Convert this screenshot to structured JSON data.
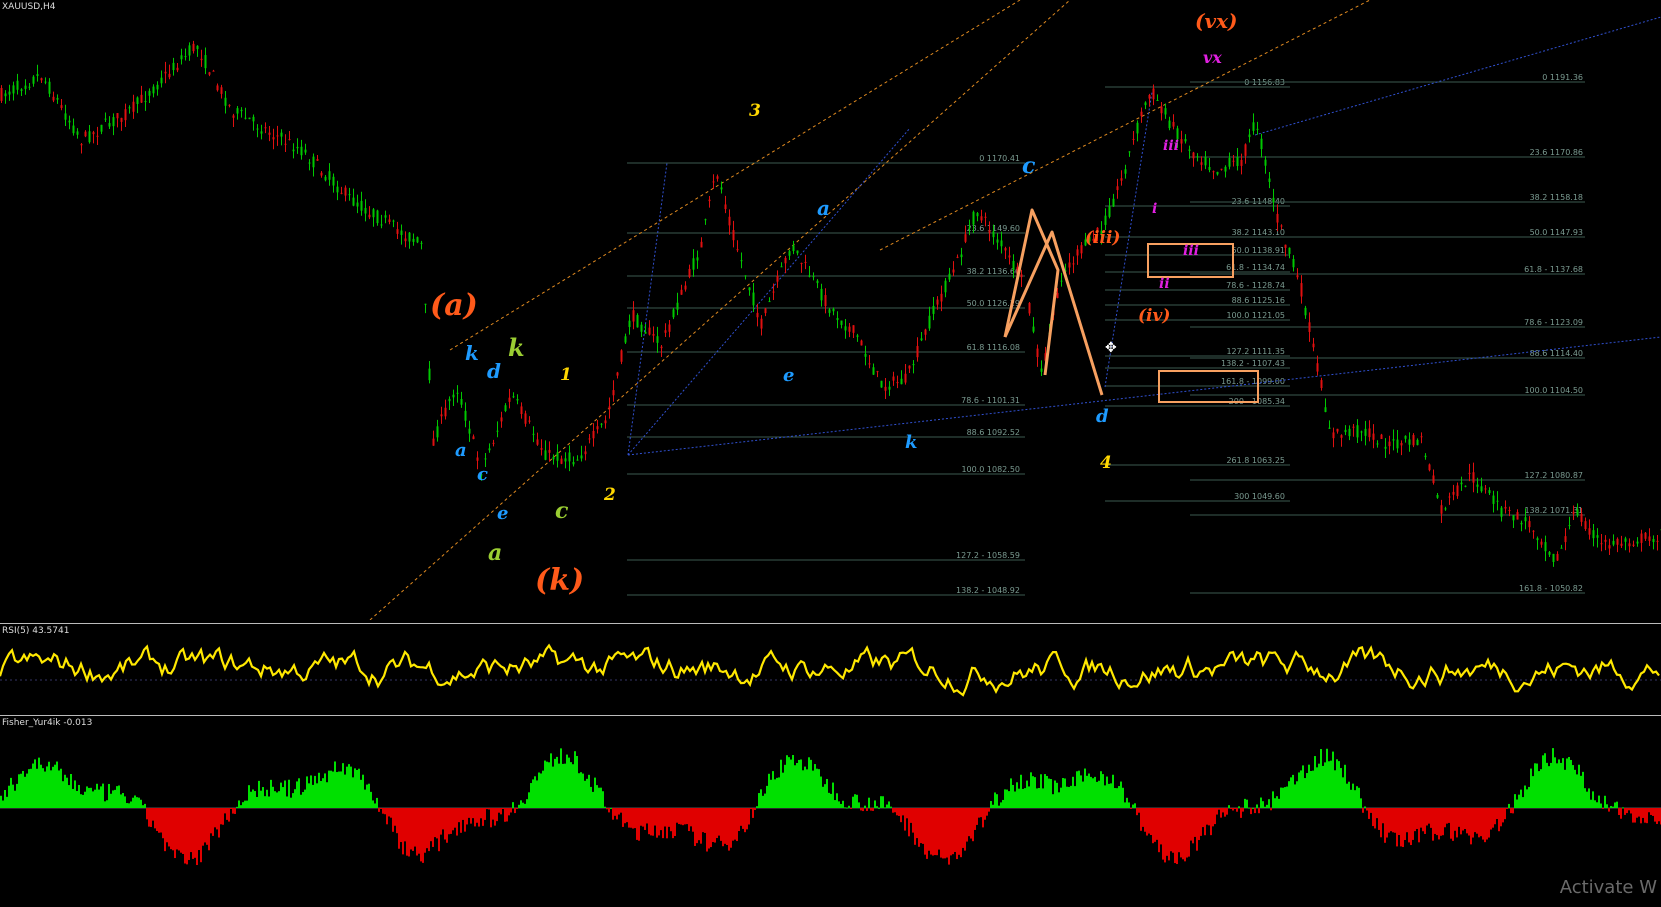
{
  "chart": {
    "symbol_title": "XAUUSD,H4",
    "colors": {
      "background": "#000000",
      "bull_candle": "#00c800",
      "bear_candle": "#e01010",
      "fib_line": "#3c5a50",
      "fib_text": "#7a9a90",
      "channel_orange": "#e08a20",
      "trend_blue": "#3050d0",
      "rsi_line": "#ffe800",
      "fisher_up": "#00e000",
      "fisher_down": "#e00000",
      "harmonic": "#f7a060"
    }
  },
  "wave_labels": [
    {
      "text": "(a)",
      "color": "#ff5a1a"
    },
    {
      "text": "(k)",
      "color": "#ff5a1a"
    },
    {
      "text": "(iii)",
      "color": "#ff5a1a"
    },
    {
      "text": "(iv)",
      "color": "#ff5a1a"
    },
    {
      "text": "(vx)",
      "color": "#ff5a1a"
    },
    {
      "text": "vx",
      "color": "#e020e0"
    },
    {
      "text": "i",
      "color": "#e020e0"
    },
    {
      "text": "ii",
      "color": "#e020e0"
    },
    {
      "text": "iii",
      "color": "#e020e0"
    },
    {
      "text": "iii",
      "color": "#e020e0"
    },
    {
      "text": "1",
      "color": "#ffd700"
    },
    {
      "text": "2",
      "color": "#ffd700"
    },
    {
      "text": "3",
      "color": "#ffd700"
    },
    {
      "text": "4",
      "color": "#ffd700"
    },
    {
      "text": "k",
      "color": "#9acd32"
    },
    {
      "text": "c",
      "color": "#9acd32"
    },
    {
      "text": "a",
      "color": "#9acd32"
    },
    {
      "text": "k",
      "color": "#1e9bff"
    },
    {
      "text": "d",
      "color": "#1e9bff"
    },
    {
      "text": "a",
      "color": "#1e9bff"
    },
    {
      "text": "c",
      "color": "#1e9bff"
    },
    {
      "text": "e",
      "color": "#1e9bff"
    },
    {
      "text": "a",
      "color": "#1e9bff"
    },
    {
      "text": "k",
      "color": "#1e9bff"
    },
    {
      "text": "c",
      "color": "#1e9bff"
    },
    {
      "text": "d",
      "color": "#1e9bff"
    },
    {
      "text": "e",
      "color": "#1e9bff"
    }
  ],
  "fib_left": [
    "0 1170.41",
    "23.6 1149.60",
    "38.2 1136.66",
    "50.0 1126.29",
    "61.8 1116.08",
    "78.6 - 1101.31",
    "88.6 1092.52",
    "100.0 1082.50",
    "127.2 - 1058.59",
    "138.2 - 1048.92"
  ],
  "fib_mid": [
    "0 1156.83",
    "23.6 1148.40",
    "38.2 1143.10",
    "50.0 1138.91",
    "61.8 - 1134.74",
    "78.6 - 1128.74",
    "88.6 1125.16",
    "100.0 1121.05",
    "127.2 1111.35",
    "138.2 - 1107.43",
    "161.8 - 1099.00",
    "200 - 1085.34",
    "261.8 1063.25",
    "300 1049.60"
  ],
  "fib_right": [
    "0 1191.36",
    "23.6 1170.86",
    "38.2 1158.18",
    "50.0 1147.93",
    "61.8 - 1137.68",
    "78.6 - 1123.09",
    "88.6 1114.40",
    "100.0 1104.50",
    "127.2 1080.87",
    "138.2 1071.31",
    "161.8 - 1050.82"
  ],
  "rsi": {
    "title": "RSI(5) 43.5741",
    "value": 43.5741
  },
  "fisher": {
    "title": "Fisher_Yur4ik -0.013",
    "value": -0.013
  },
  "watermark": "Activate W"
}
